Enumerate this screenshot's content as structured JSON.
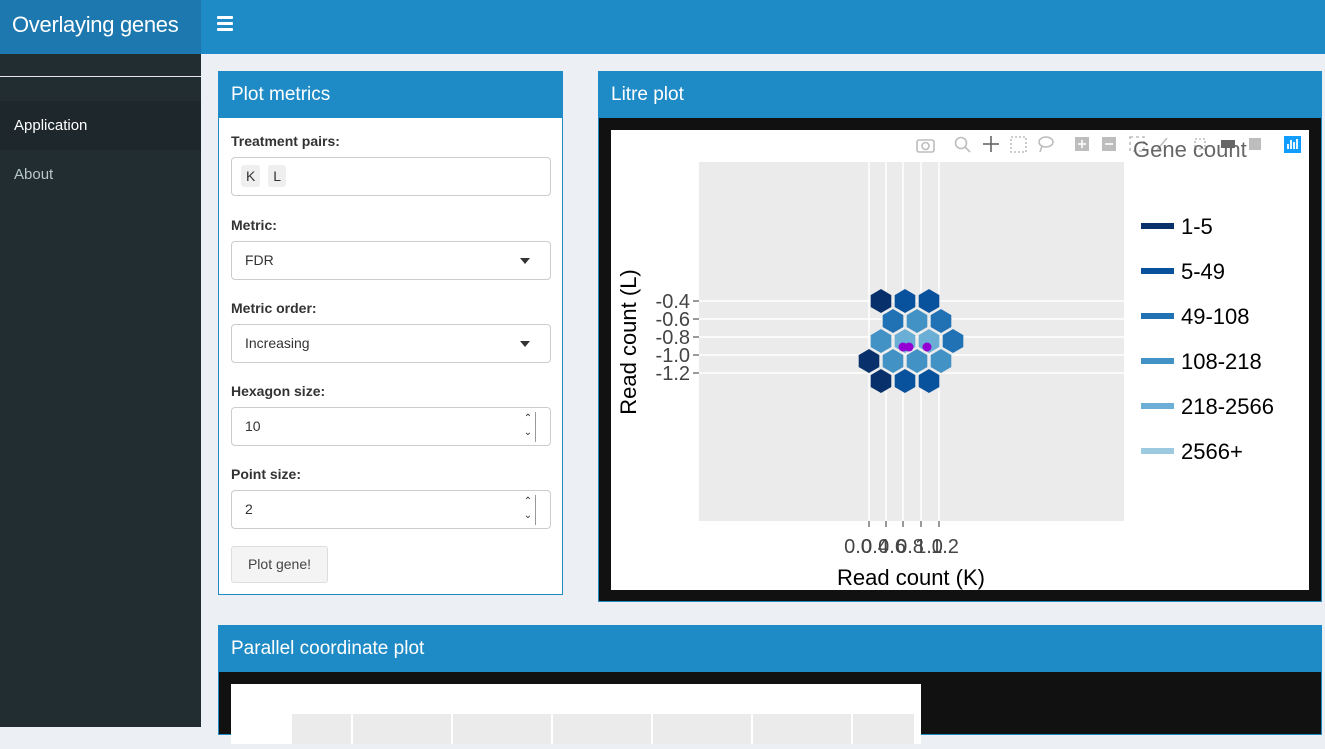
{
  "header": {
    "app_title": "Overlaying genes",
    "menu_icon": "hamburger-icon"
  },
  "sidebar": {
    "items": [
      {
        "label": "Application",
        "active": true
      },
      {
        "label": "About",
        "active": false
      }
    ]
  },
  "metrics_panel": {
    "title": "Plot metrics",
    "treatment_pairs": {
      "label": "Treatment pairs:",
      "values": [
        "K",
        "L"
      ]
    },
    "metric": {
      "label": "Metric:",
      "value": "FDR"
    },
    "metric_order": {
      "label": "Metric order:",
      "value": "Increasing"
    },
    "hexagon_size": {
      "label": "Hexagon size:",
      "value": "10"
    },
    "point_size": {
      "label": "Point size:",
      "value": "2"
    },
    "button_label": "Plot gene!"
  },
  "litre_panel": {
    "title": "Litre plot",
    "toolbar_icons": [
      "camera-icon",
      "zoom-icon",
      "pan-icon",
      "box-select-icon",
      "lasso-icon",
      "zoom-in-icon",
      "zoom-out-icon",
      "autoscale-icon",
      "reset-axes-icon",
      "spike-lines-icon",
      "hover-closest-icon",
      "hover-compare-icon",
      "plotly-logo-icon"
    ]
  },
  "chart_data": {
    "type": "hexbin",
    "xlabel": "Read count (K)",
    "ylabel": "Read count (L)",
    "x_tick_labels": [
      "0.0",
      "0.4",
      "0.6",
      "0.8",
      "1.0",
      "1.2"
    ],
    "y_tick_labels": [
      "-0.4",
      "-0.6",
      "-0.8",
      "-1.0",
      "-1.2"
    ],
    "legend_title": "Gene count",
    "legend": [
      {
        "label": "1-5",
        "color": "#08306b"
      },
      {
        "label": "5-49",
        "color": "#08519c"
      },
      {
        "label": "49-108",
        "color": "#2171b5"
      },
      {
        "label": "108-218",
        "color": "#4292c6"
      },
      {
        "label": "218-2566",
        "color": "#6baed6"
      },
      {
        "label": "2566+",
        "color": "#9ecae1"
      }
    ],
    "points_color": "#9400d3"
  },
  "pc_panel": {
    "title": "Parallel coordinate plot"
  }
}
